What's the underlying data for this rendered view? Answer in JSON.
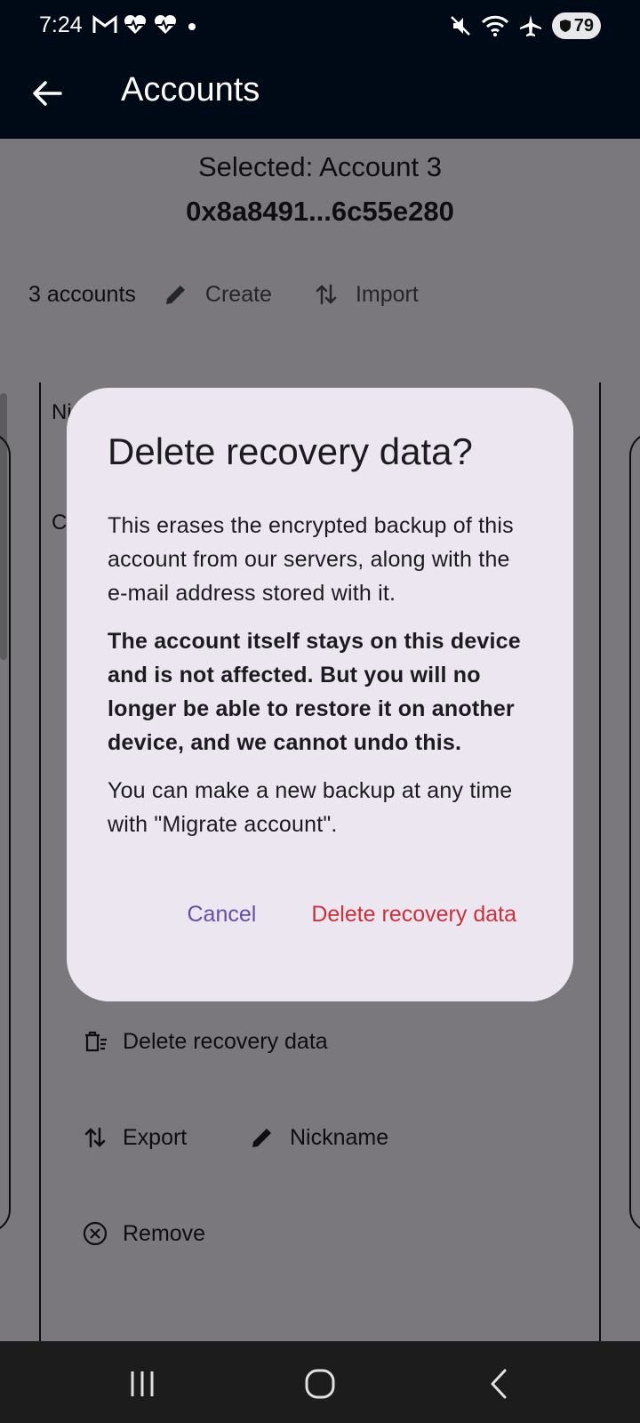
{
  "status_bar": {
    "time": "7:24",
    "left_icons": [
      "gmail-icon",
      "health-heart-icon",
      "health-heart-icon",
      "dot-icon"
    ],
    "right_icons": [
      "mute-icon",
      "wifi-icon",
      "airplane-icon"
    ],
    "battery": "79"
  },
  "app_bar": {
    "back_icon": "arrow-back-icon",
    "title": "Accounts"
  },
  "selected": {
    "label": "Selected: Account 3",
    "address": "0x8a8491...6c55e280"
  },
  "accounts_row": {
    "count": "3 accounts",
    "create_label": "Create",
    "import_label": "Import"
  },
  "card": {
    "fragment_1": "Ni",
    "fragment_2": "C",
    "delete_recovery_label": "Delete recovery data",
    "export_label": "Export",
    "nickname_label": "Nickname",
    "remove_label": "Remove"
  },
  "dialog": {
    "title": "Delete recovery data?",
    "paragraph_1": "This erases the encrypted backup of this account from our servers, along with the e-mail address stored with it.",
    "paragraph_2": "The account itself stays on this device and is not affected. But you will no longer be able to restore it on another device, and we cannot undo this.",
    "paragraph_3": "You can make a new backup at any time with \"Migrate account\".",
    "cancel_label": "Cancel",
    "confirm_label": "Delete recovery data"
  },
  "colors": {
    "app_bar": "#000a16",
    "dialog_bg": "#ece6f0",
    "cancel": "#6750a4",
    "destructive": "#c9313b"
  },
  "nav_bar": {
    "icons": [
      "recents-icon",
      "home-icon",
      "back-icon"
    ]
  }
}
